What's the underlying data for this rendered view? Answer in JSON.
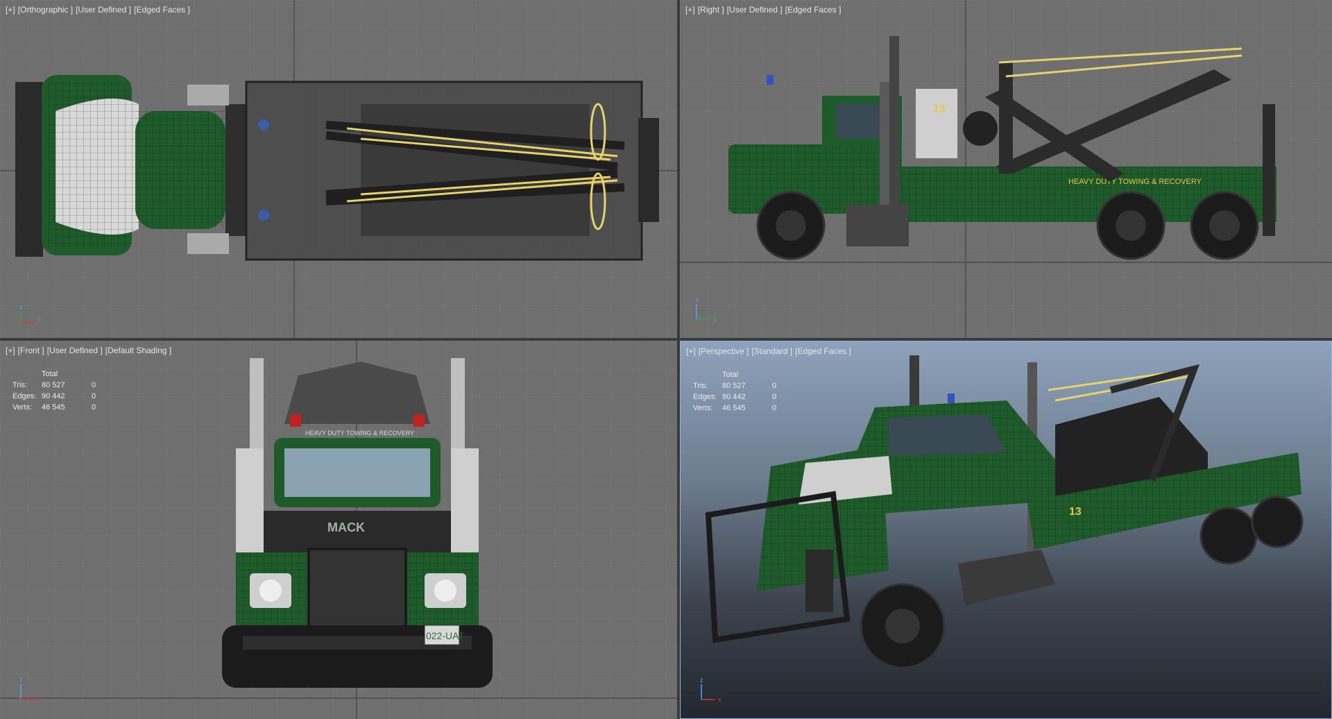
{
  "viewports": {
    "top": {
      "labels": [
        "[+]",
        "[Orthographic ]",
        "[User Defined ]",
        "[Edged Faces ]"
      ],
      "axis": [
        "y",
        "z"
      ]
    },
    "right": {
      "labels": [
        "[+]",
        "[Right ]",
        "[User Defined ]",
        "[Edged Faces ]"
      ],
      "axis": [
        "z",
        "y"
      ]
    },
    "front": {
      "labels": [
        "[+]",
        "[Front ]",
        "[User Defined ]",
        "[Default Shading ]"
      ],
      "axis": [
        "z",
        "x"
      ]
    },
    "perspective": {
      "labels": [
        "[+]",
        "[Perspective ]",
        "[Standard ]",
        "[Edged Faces ]"
      ],
      "axis": [
        "z",
        "x"
      ]
    }
  },
  "stats": {
    "header": "Total",
    "rows": [
      {
        "key": "Tris:",
        "total": "80 527",
        "sel": "0"
      },
      {
        "key": "Edges:",
        "total": "90 442",
        "sel": "0"
      },
      {
        "key": "Verts:",
        "total": "46 545",
        "sel": "0"
      }
    ]
  },
  "truck": {
    "number": "13",
    "side_text": "HEAVY DUTY TOWING & RECOVERY",
    "front_badge": "MACK",
    "plate": "022-UAT",
    "header_text": "HEAVY DUTY TOWING & RECOVERY"
  },
  "colors": {
    "viewport_bg": "#6f6f6f",
    "body_green": "#1f5a2a",
    "straps": "#e8d26a",
    "active_border": "#8fb7e6"
  }
}
